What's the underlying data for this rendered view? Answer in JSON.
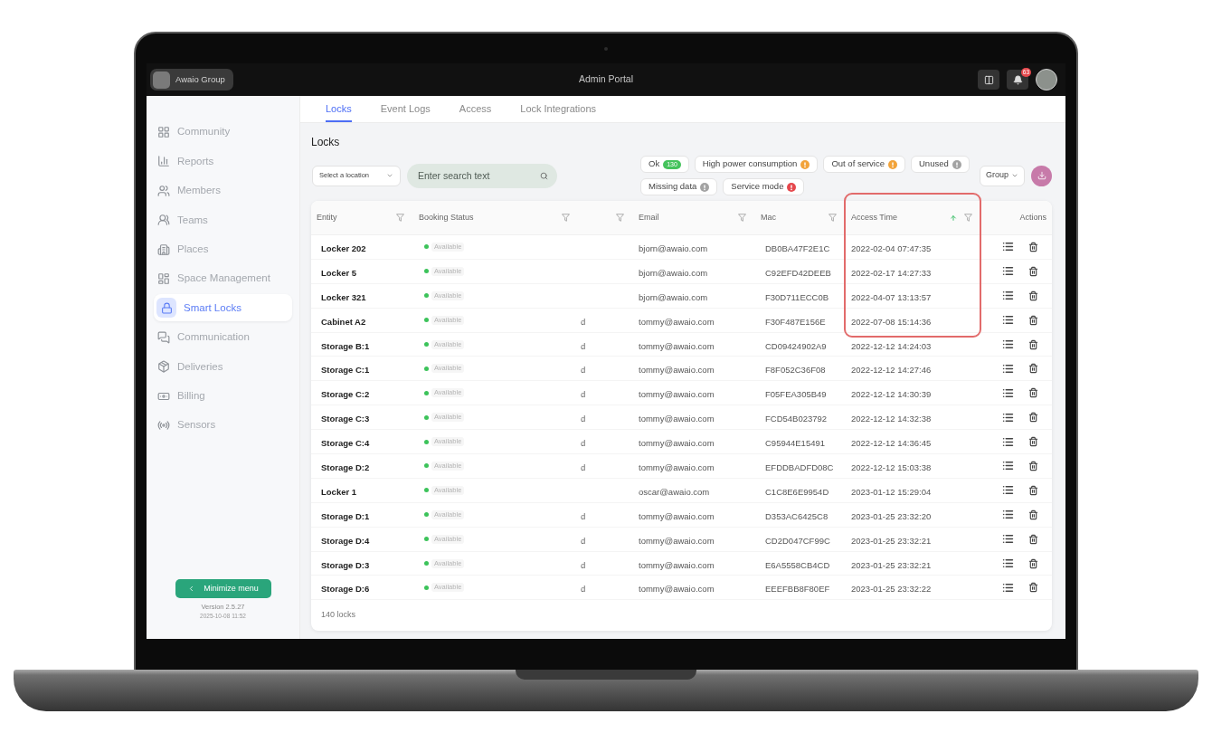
{
  "top_bar": {
    "org_name": "Awaio Group",
    "title": "Admin Portal",
    "notification_badge": "63"
  },
  "sidebar": {
    "items": [
      {
        "label": "Community",
        "selected": false
      },
      {
        "label": "Reports",
        "selected": false
      },
      {
        "label": "Members",
        "selected": false
      },
      {
        "label": "Teams",
        "selected": false
      },
      {
        "label": "Places",
        "selected": false
      },
      {
        "label": "Space Management",
        "selected": false
      },
      {
        "label": "Smart Locks",
        "selected": true
      },
      {
        "label": "Communication",
        "selected": false
      },
      {
        "label": "Deliveries",
        "selected": false
      },
      {
        "label": "Billing",
        "selected": false
      },
      {
        "label": "Sensors",
        "selected": false
      }
    ],
    "minimize_button": "Minimize menu",
    "version": "Version 2.5.27",
    "build_date": "2025-10-08 11:52"
  },
  "tabs": [
    {
      "label": "Locks",
      "selected": true
    },
    {
      "label": "Event Logs",
      "selected": false
    },
    {
      "label": "Access",
      "selected": false
    },
    {
      "label": "Lock Integrations",
      "selected": false
    }
  ],
  "page_title": "Locks",
  "toolbar": {
    "location_select": {
      "placeholder": "Select a location"
    },
    "search": {
      "placeholder": "Enter search text"
    },
    "status_filters": [
      {
        "label": "Ok",
        "count": "130",
        "color": "#45c35c"
      },
      {
        "label": "High power consumption",
        "color": "#f2a33a"
      },
      {
        "label": "Out of service",
        "color": "#f2a33a"
      },
      {
        "label": "Unused",
        "color": "#a3a3a3"
      },
      {
        "label": "Missing data",
        "color": "#a3a3a3"
      },
      {
        "label": "Service mode",
        "color": "#e5484d"
      }
    ],
    "group_select": {
      "value": "Group"
    }
  },
  "table": {
    "columns": [
      {
        "label": "Entity",
        "filterable": true
      },
      {
        "label": "Booking Status",
        "filterable": true
      },
      {
        "filterable": true
      },
      {
        "label": "Email",
        "filterable": true
      },
      {
        "label": "Mac",
        "filterable": true
      },
      {
        "label": "Access Time",
        "filterable": true,
        "sorted_ascending": true
      },
      {
        "label": "Actions"
      }
    ],
    "rows": [
      {
        "entity": "Locker 202",
        "booking_status": "Available",
        "email": "bjorn@awaio.com",
        "mac": "DB0BA47F2E1C",
        "access_time": "2022-02-04 07:47:35"
      },
      {
        "entity": "Locker 5",
        "booking_status": "Available",
        "email": "bjorn@awaio.com",
        "mac": "C92EFD42DEEB",
        "access_time": "2022-02-17 14:27:33"
      },
      {
        "entity": "Locker 321",
        "booking_status": "Available",
        "email": "bjorn@awaio.com",
        "mac": "F30D711ECC0B",
        "access_time": "2022-04-07 13:13:57"
      },
      {
        "entity": "Cabinet A2",
        "booking_status": "Available",
        "column_3": "d",
        "email": "tommy@awaio.com",
        "mac": "F30F487E156E",
        "access_time": "2022-07-08 15:14:36"
      },
      {
        "entity": "Storage B:1",
        "booking_status": "Available",
        "column_3": "d",
        "email": "tommy@awaio.com",
        "mac": "CD09424902A9",
        "access_time": "2022-12-12 14:24:03"
      },
      {
        "entity": "Storage C:1",
        "booking_status": "Available",
        "column_3": "d",
        "email": "tommy@awaio.com",
        "mac": "F8F052C36F08",
        "access_time": "2022-12-12 14:27:46"
      },
      {
        "entity": "Storage C:2",
        "booking_status": "Available",
        "column_3": "d",
        "email": "tommy@awaio.com",
        "mac": "F05FEA305B49",
        "access_time": "2022-12-12 14:30:39"
      },
      {
        "entity": "Storage C:3",
        "booking_status": "Available",
        "column_3": "d",
        "email": "tommy@awaio.com",
        "mac": "FCD54B023792",
        "access_time": "2022-12-12 14:32:38"
      },
      {
        "entity": "Storage C:4",
        "booking_status": "Available",
        "column_3": "d",
        "email": "tommy@awaio.com",
        "mac": "C95944E15491",
        "access_time": "2022-12-12 14:36:45"
      },
      {
        "entity": "Storage D:2",
        "booking_status": "Available",
        "column_3": "d",
        "email": "tommy@awaio.com",
        "mac": "EFDDBADFD08C",
        "access_time": "2022-12-12 15:03:38"
      },
      {
        "entity": "Locker 1",
        "booking_status": "Available",
        "email": "oscar@awaio.com",
        "mac": "C1C8E6E9954D",
        "access_time": "2023-01-12 15:29:04"
      },
      {
        "entity": "Storage D:1",
        "booking_status": "Available",
        "column_3": "d",
        "email": "tommy@awaio.com",
        "mac": "D353AC6425C8",
        "access_time": "2023-01-25 23:32:20"
      },
      {
        "entity": "Storage D:4",
        "booking_status": "Available",
        "column_3": "d",
        "email": "tommy@awaio.com",
        "mac": "CD2D047CF99C",
        "access_time": "2023-01-25 23:32:21"
      },
      {
        "entity": "Storage D:3",
        "booking_status": "Available",
        "column_3": "d",
        "email": "tommy@awaio.com",
        "mac": "E6A5558CB4CD",
        "access_time": "2023-01-25 23:32:21"
      },
      {
        "entity": "Storage D:6",
        "booking_status": "Available",
        "column_3": "d",
        "email": "tommy@awaio.com",
        "mac": "EEEFBB8F80EF",
        "access_time": "2023-01-25 23:32:22"
      }
    ],
    "footer": "140 locks"
  }
}
